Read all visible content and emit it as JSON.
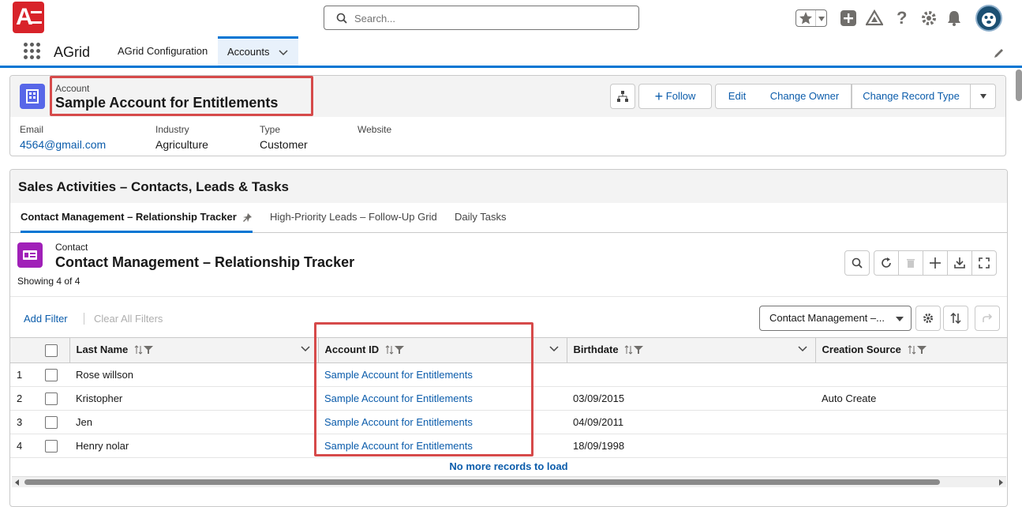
{
  "header": {
    "logo_letter": "A",
    "search_placeholder": "Search...",
    "icons": [
      "favorites-star-icon",
      "add-icon",
      "trailhead-icon",
      "help-icon",
      "setup-gear-icon",
      "notifications-bell-icon",
      "user-avatar"
    ]
  },
  "nav": {
    "app_name": "AGrid",
    "items": [
      {
        "label": "AGrid Configuration",
        "active": false
      },
      {
        "label": "Accounts",
        "active": true
      }
    ]
  },
  "record": {
    "object_label": "Account",
    "title": "Sample Account for Entitlements",
    "actions": {
      "follow": "Follow",
      "edit": "Edit",
      "change_owner": "Change Owner",
      "change_record_type": "Change Record Type"
    },
    "fields": [
      {
        "label": "Email",
        "value": "4564@gmail.com",
        "link": true
      },
      {
        "label": "Industry",
        "value": "Agriculture",
        "link": false
      },
      {
        "label": "Type",
        "value": "Customer",
        "link": false
      },
      {
        "label": "Website",
        "value": "",
        "link": false
      }
    ]
  },
  "related": {
    "card_title": "Sales Activities – Contacts, Leads & Tasks",
    "tabs": [
      {
        "label": "Contact Management – Relationship Tracker",
        "active": true
      },
      {
        "label": "High-Priority Leads – Follow-Up Grid",
        "active": false
      },
      {
        "label": "Daily Tasks",
        "active": false
      }
    ],
    "grid": {
      "object_label": "Contact",
      "title": "Contact Management – Relationship Tracker",
      "showing": "Showing 4 of 4",
      "add_filter": "Add Filter",
      "clear_filters": "Clear All Filters",
      "view_select": "Contact Management –...",
      "columns": [
        "Last Name",
        "Account ID",
        "Birthdate",
        "Creation Source"
      ],
      "rows": [
        {
          "num": "1",
          "last_name": "Rose willson",
          "account": "Sample Account for Entitlements",
          "birthdate": "",
          "source": ""
        },
        {
          "num": "2",
          "last_name": "Kristopher",
          "account": "Sample Account for Entitlements",
          "birthdate": "03/09/2015",
          "source": "Auto Create"
        },
        {
          "num": "3",
          "last_name": "Jen",
          "account": "Sample Account for Entitlements",
          "birthdate": "04/09/2011",
          "source": ""
        },
        {
          "num": "4",
          "last_name": "Henry nolar",
          "account": "Sample Account for Entitlements",
          "birthdate": "18/09/1998",
          "source": ""
        }
      ],
      "no_more": "No more records to load"
    }
  },
  "colors": {
    "brand_blue": "#0176d3",
    "link_blue": "#0b5cab",
    "highlight_red": "#d64a4a",
    "account_icon": "#5867e8",
    "contact_icon": "#a020b8"
  }
}
